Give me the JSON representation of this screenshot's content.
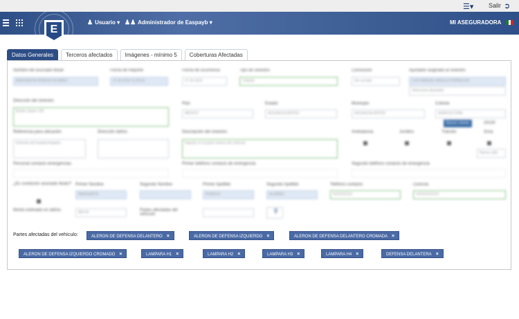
{
  "topbar": {
    "exit_label": "Salir"
  },
  "navbar": {
    "user_menu": "Usuario",
    "admin_menu": "Administrador de Easpayb",
    "company": "MI ASEGURADORA",
    "logo_letter": "E"
  },
  "tabs": [
    {
      "label": "Datos Generales",
      "active": true
    },
    {
      "label": "Terceros afectados",
      "active": false
    },
    {
      "label": "Imágenes - mínimo 5",
      "active": false
    },
    {
      "label": "Coberturas Afectadas",
      "active": false
    }
  ],
  "form": {
    "labels": {
      "nombre": "Nombre del asociado titular",
      "fecha_reporte": "Fecha de Reporte",
      "fecha_ocurrencia": "Fecha de ocurrencia",
      "tipo_siniestro": "Tipo de siniestro",
      "conclusion": "Conclusión",
      "ajustador": "Ajustador asignado al siniestro",
      "direccion": "Dirección del siniestro",
      "pais": "País",
      "estado": "Estado",
      "municipio": "Municipio",
      "colonia": "Colonia",
      "referencia": "Referencia para ubicación",
      "danos": "Dirección daños",
      "descripcion": "Descripción del siniestro",
      "ambulancia": "Ambulancia",
      "juridico": "Jurídico",
      "transito": "Tránsito",
      "grua": "Grúa",
      "contacto_emergencia": "Personal contacto emergencias",
      "telefono_emergencia": "Primer teléfono contacto de emergencia",
      "segundo_telefono": "Segundo teléfono contacto de emergencia",
      "conductor": "¿Es conductor asociado titular?",
      "primer_nombre": "Primer Nombre",
      "segundo_nombre": "Segundo Nombre",
      "primer_apellido": "Primer Apellido",
      "segundo_apellido": "Segundo Apellido",
      "telefono_contacto": "Teléfono contacto",
      "licencia": "Licencia",
      "monto": "Monto estimado en daños",
      "partes_afectadas": "Partes afectadas del vehículo"
    },
    "values": {
      "nombre": "MARGARITA PEREGO ALVAREZ",
      "fecha_reporte": "27-03-2019 11:30:15",
      "fecha_ocurrencia": "27-03-2019",
      "tipo_siniestro": "Colisión",
      "conclusion": "Sin cerrado",
      "ajustador": "LUIS MANUEL ANGULO PEÑUELAS",
      "ajustador_select": "Seleccione Ajustador",
      "direccion": "Benito Juarez 100",
      "pais": "MEXICO",
      "estado": "AGUASCALIENTES",
      "municipio": "AGUASCALIENTES",
      "colonia": "AGRICULTURA",
      "referencia": "Enfrente del hospital Angeles",
      "descripcion": "Impacto en la parte trasera del vehículo",
      "primer_nombre": "MARGARITA",
      "primer_apellido": "PEREGO",
      "segundo_apellido": "ALVAREZ",
      "telefono_contacto": "4191510123",
      "licencia": "XXXXXXXXXX",
      "monto": "$00.00",
      "btn_buscar": "Buscar colonia",
      "btn_cp": "20130",
      "btn_otro": "Nueva calle"
    }
  },
  "parts": {
    "label": "Partes afectadas del vehículo:",
    "chips": [
      "ALERON DE DEFENSA DELANTERO",
      "ALERON DE DEFENSA IZQUIERDO",
      "ALERON DE DEFENSA DELANTERO CROMADA",
      "ALERON DE DEFENSA IZQUIERDO CROMADO",
      "LAMPARA H1",
      "LAMPARA H2",
      "LAMPARA H3",
      "LAMPARA H4",
      "DEFENSA DELANTERA"
    ],
    "remove_symbol": "×"
  },
  "colors": {
    "primary": "#2d4d85",
    "chip": "#4a6aa5"
  }
}
